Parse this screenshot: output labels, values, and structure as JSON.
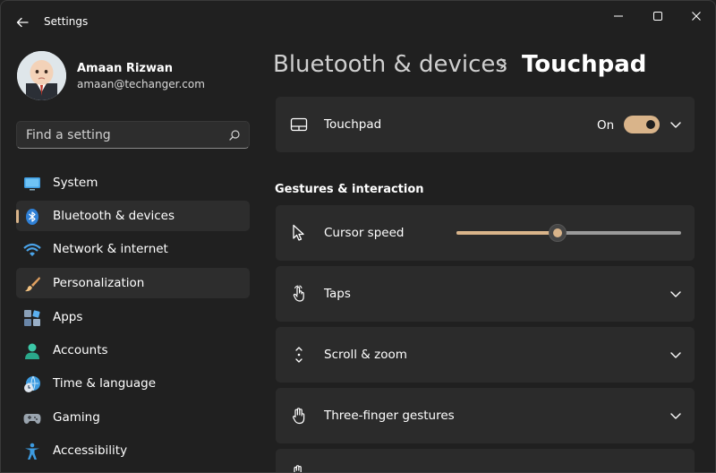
{
  "window": {
    "title": "Settings"
  },
  "profile": {
    "name": "Amaan Rizwan",
    "email": "amaan@techanger.com"
  },
  "search": {
    "placeholder": "Find a setting"
  },
  "sidebar": {
    "items": [
      {
        "label": "System",
        "icon": "system-icon"
      },
      {
        "label": "Bluetooth & devices",
        "icon": "bluetooth-icon",
        "selected": true
      },
      {
        "label": "Network & internet",
        "icon": "wifi-icon"
      },
      {
        "label": "Personalization",
        "icon": "brush-icon"
      },
      {
        "label": "Apps",
        "icon": "apps-icon"
      },
      {
        "label": "Accounts",
        "icon": "accounts-icon"
      },
      {
        "label": "Time & language",
        "icon": "time-language-icon"
      },
      {
        "label": "Gaming",
        "icon": "gamepad-icon"
      },
      {
        "label": "Accessibility",
        "icon": "accessibility-icon"
      }
    ]
  },
  "breadcrumb": {
    "parent": "Bluetooth & devices",
    "current": "Touchpad"
  },
  "touchpad": {
    "label": "Touchpad",
    "state": "On",
    "enabled": true
  },
  "gestures": {
    "heading": "Gestures & interaction",
    "cursor_speed_label": "Cursor speed",
    "cursor_speed_value": 0.45,
    "taps_label": "Taps",
    "scroll_zoom_label": "Scroll & zoom",
    "three_finger_label": "Three-finger gestures"
  },
  "colors": {
    "accent": "#d9b48a",
    "background": "#202020",
    "card": "#2b2b2b"
  }
}
